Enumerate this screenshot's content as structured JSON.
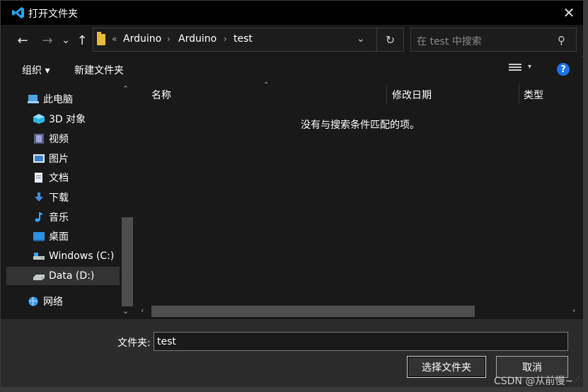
{
  "window": {
    "title": "打开文件夹",
    "close_glyph": "✕"
  },
  "nav": {
    "back_glyph": "←",
    "forward_glyph": "→",
    "recent_glyph": "⌄",
    "up_glyph": "↑",
    "overflow_glyph": "«",
    "breadcrumbs": [
      "Arduino",
      "Arduino",
      "test"
    ],
    "separator_glyph": "›",
    "dropdown_glyph": "⌄",
    "refresh_glyph": "↻"
  },
  "search": {
    "placeholder": "在 test 中搜索",
    "icon_glyph": "⚲"
  },
  "toolbar": {
    "organize_label": "组织 ▾",
    "new_folder_label": "新建文件夹",
    "view_caret": "▾",
    "help_glyph": "?"
  },
  "sidebar": {
    "items": [
      {
        "label": "此电脑",
        "icon": "this-pc-icon"
      },
      {
        "label": "3D 对象",
        "icon": "3d-objects-icon"
      },
      {
        "label": "视频",
        "icon": "videos-icon"
      },
      {
        "label": "图片",
        "icon": "pictures-icon"
      },
      {
        "label": "文档",
        "icon": "documents-icon"
      },
      {
        "label": "下载",
        "icon": "downloads-icon"
      },
      {
        "label": "音乐",
        "icon": "music-icon"
      },
      {
        "label": "桌面",
        "icon": "desktop-icon"
      },
      {
        "label": "Windows (C:)",
        "icon": "drive-c-icon"
      },
      {
        "label": "Data (D:)",
        "icon": "drive-d-icon",
        "selected": true
      },
      {
        "label": "网络",
        "icon": "network-icon"
      }
    ],
    "scroll_up": "⌃",
    "scroll_down": "⌄"
  },
  "content": {
    "columns": [
      "名称",
      "修改日期",
      "类型"
    ],
    "sort_glyph": "⌃",
    "empty_message": "没有与搜索条件匹配的项。",
    "scroll_left": "‹",
    "scroll_right": "›"
  },
  "footer": {
    "folder_label": "文件夹:",
    "folder_value": "test",
    "select_button": "选择文件夹",
    "cancel_button": "取消"
  },
  "watermark": "CSDN @从前慢~",
  "colors": {
    "accent": "#1a73e8",
    "folder": "#e8b93b",
    "vscode_blue": "#23a9f2"
  }
}
